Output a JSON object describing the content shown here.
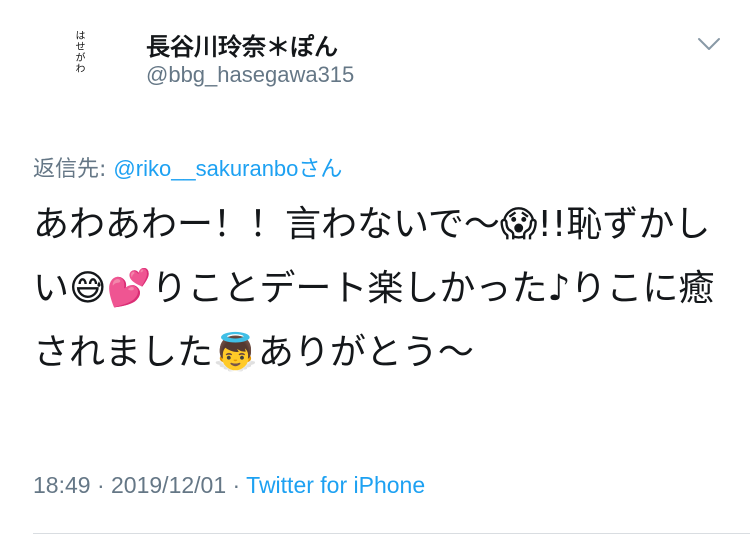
{
  "author": {
    "avatar_text": "はせがわ",
    "display_name": "長谷川玲奈＊ぽん",
    "handle": "@bbg_hasegawa315"
  },
  "menu": {
    "icon": "chevron-down-icon"
  },
  "reply": {
    "prefix": "返信先: ",
    "handle": "@riko__sakuranbo",
    "suffix": "さん"
  },
  "tweet": {
    "text": "あわあわー！！言わないで〜😱!!恥ずかしい😅💕りことデート楽しかった♪りこに癒されました👼ありがとう〜"
  },
  "meta": {
    "time": "18:49",
    "separator1": " · ",
    "date": "2019/12/01",
    "separator2": " · ",
    "source": "Twitter for iPhone"
  },
  "colors": {
    "text": "#14171a",
    "secondary": "#657786",
    "link": "#1da1f2",
    "divider": "#d9dde1"
  }
}
